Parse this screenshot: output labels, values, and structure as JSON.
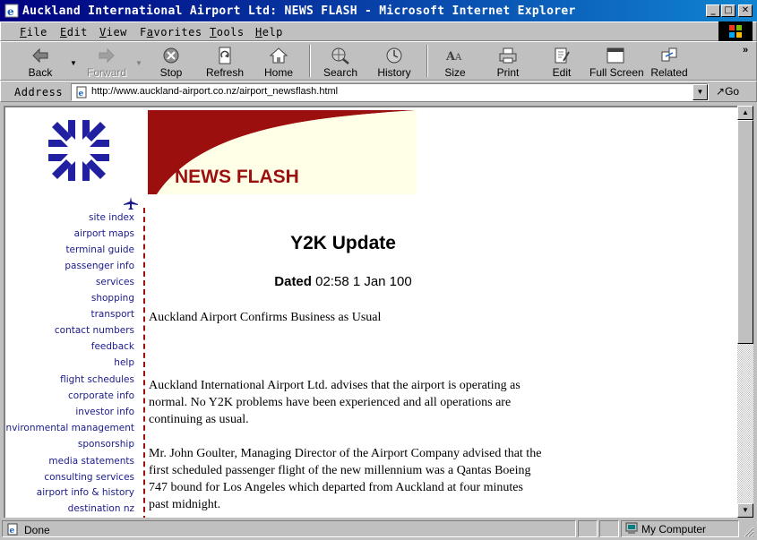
{
  "window": {
    "title": "Auckland International Airport Ltd: NEWS FLASH - Microsoft Internet Explorer",
    "minimize": "_",
    "maximize": "□",
    "close": "✕"
  },
  "menu": {
    "items": [
      {
        "label": "File",
        "key": "F",
        "rest": "ile"
      },
      {
        "label": "Edit",
        "key": "E",
        "rest": "dit"
      },
      {
        "label": "View",
        "key": "V",
        "rest": "iew"
      },
      {
        "label": "Favorites",
        "key": "a",
        "pre": "F",
        "rest": "vorites"
      },
      {
        "label": "Tools",
        "key": "T",
        "rest": "ools"
      },
      {
        "label": "Help",
        "key": "H",
        "rest": "elp"
      }
    ]
  },
  "toolbar": {
    "back": "Back",
    "forward": "Forward",
    "stop": "Stop",
    "refresh": "Refresh",
    "home": "Home",
    "search": "Search",
    "history": "History",
    "size": "Size",
    "print": "Print",
    "edit": "Edit",
    "fullscreen": "Full Screen",
    "related": "Related",
    "more": "»"
  },
  "address": {
    "label": "Address",
    "url": "http://www.auckland-airport.co.nz/airport_newsflash.html",
    "go": "Go"
  },
  "page": {
    "banner_title": "NEWS FLASH",
    "nav": [
      "site index",
      "airport maps",
      "terminal guide",
      "passenger info",
      "services",
      "shopping",
      "transport",
      "contact numbers",
      "feedback",
      "help",
      "flight schedules",
      "corporate info",
      "investor info",
      "environmental management",
      "sponsorship",
      "media statements",
      "consulting services",
      "airport info & history",
      "destination nz"
    ],
    "article_title": "Y2K Update",
    "dated_label": "Dated",
    "dated_value": " 02:58 1 Jan 100",
    "subtitle": "Auckland Airport Confirms Business as Usual",
    "paragraph1": "Auckland International Airport Ltd. advises that the airport is operating as normal. No Y2K problems have been experienced and all operations are continuing as usual.",
    "paragraph2": "Mr. John Goulter, Managing Director of the Airport Company advised that the first scheduled passenger flight of the new millennium was a Qantas Boeing 747 bound for Los Angeles which departed from Auckland at four minutes past midnight."
  },
  "status": {
    "text": "Done",
    "zone": "My Computer"
  },
  "colors": {
    "title_gradient_start": "#000080",
    "title_gradient_end": "#1084d0",
    "banner_red": "#9b0f0f",
    "nav_link": "#1a1a8c",
    "logo_blue": "#2020a0"
  }
}
